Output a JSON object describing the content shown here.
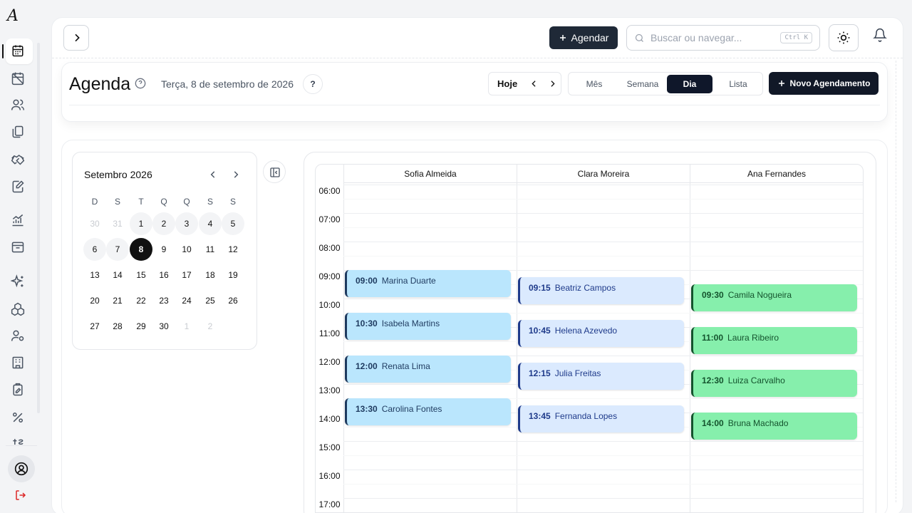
{
  "app": {
    "logo": "A"
  },
  "sidebar": {
    "items": [
      {
        "icon": "calendar-icon",
        "active": true
      },
      {
        "icon": "calendar-off-icon"
      },
      {
        "icon": "users-icon"
      },
      {
        "icon": "files-icon"
      },
      {
        "icon": "handshake-icon"
      },
      {
        "icon": "document-edit-icon"
      },
      {
        "icon": "chart-line-icon"
      },
      {
        "icon": "archive-icon"
      },
      {
        "icon": "sparkles-icon"
      },
      {
        "icon": "boxes-icon"
      },
      {
        "icon": "user-cog-icon"
      },
      {
        "icon": "building-icon"
      },
      {
        "icon": "clipboard-edit-icon"
      },
      {
        "icon": "percent-icon"
      },
      {
        "icon": "currency-icon"
      }
    ],
    "avatar_icon": "user-circle-icon",
    "logout_icon": "logout-icon"
  },
  "topbar": {
    "agendar_label": "Agendar",
    "search_placeholder": "Buscar ou navegar...",
    "search_shortcut": "Ctrl K"
  },
  "header": {
    "title": "Agenda",
    "date": "Terça, 8 de setembro de 2026",
    "help_label": "?",
    "today_label": "Hoje",
    "views": [
      "Mês",
      "Semana",
      "Dia",
      "Lista"
    ],
    "active_view": "Dia",
    "new_appointment_label": "Novo Agendamento"
  },
  "mini_calendar": {
    "month_label": "Setembro 2026",
    "weekdays": [
      "D",
      "S",
      "T",
      "Q",
      "Q",
      "S",
      "S"
    ],
    "weeks": [
      [
        {
          "d": "30",
          "m": true
        },
        {
          "d": "31",
          "m": true
        },
        {
          "d": "1",
          "hl": true
        },
        {
          "d": "2",
          "hl": true
        },
        {
          "d": "3",
          "hl": true
        },
        {
          "d": "4",
          "hl": true
        },
        {
          "d": "5",
          "hl": true
        }
      ],
      [
        {
          "d": "6",
          "hl": true
        },
        {
          "d": "7",
          "hl": true
        },
        {
          "d": "8",
          "today": true
        },
        {
          "d": "9"
        },
        {
          "d": "10"
        },
        {
          "d": "11"
        },
        {
          "d": "12"
        }
      ],
      [
        {
          "d": "13"
        },
        {
          "d": "14"
        },
        {
          "d": "15"
        },
        {
          "d": "16"
        },
        {
          "d": "17"
        },
        {
          "d": "18"
        },
        {
          "d": "19"
        }
      ],
      [
        {
          "d": "20"
        },
        {
          "d": "21"
        },
        {
          "d": "22"
        },
        {
          "d": "23"
        },
        {
          "d": "24"
        },
        {
          "d": "25"
        },
        {
          "d": "26"
        }
      ],
      [
        {
          "d": "27"
        },
        {
          "d": "28"
        },
        {
          "d": "29"
        },
        {
          "d": "30"
        },
        {
          "d": "1",
          "m": true
        },
        {
          "d": "2",
          "m": true
        }
      ]
    ]
  },
  "day_view": {
    "columns": [
      "Sofia Almeida",
      "Clara Moreira",
      "Ana Fernandes"
    ],
    "hours": [
      "06:00",
      "07:00",
      "08:00",
      "09:00",
      "10:00",
      "11:00",
      "12:00",
      "13:00",
      "14:00",
      "15:00",
      "16:00",
      "17:00"
    ],
    "events": [
      {
        "col": 0,
        "time": "09:00",
        "name": "Marina Duarte",
        "theme": "blue"
      },
      {
        "col": 0,
        "time": "10:30",
        "name": "Isabela Martins",
        "theme": "blue"
      },
      {
        "col": 0,
        "time": "12:00",
        "name": "Renata Lima",
        "theme": "blue"
      },
      {
        "col": 0,
        "time": "13:30",
        "name": "Carolina Fontes",
        "theme": "blue"
      },
      {
        "col": 1,
        "time": "09:15",
        "name": "Beatriz Campos",
        "theme": "lav"
      },
      {
        "col": 1,
        "time": "10:45",
        "name": "Helena Azevedo",
        "theme": "lav"
      },
      {
        "col": 1,
        "time": "12:15",
        "name": "Julia Freitas",
        "theme": "lav"
      },
      {
        "col": 1,
        "time": "13:45",
        "name": "Fernanda Lopes",
        "theme": "lav"
      },
      {
        "col": 2,
        "time": "09:30",
        "name": "Camila Nogueira",
        "theme": "green"
      },
      {
        "col": 2,
        "time": "11:00",
        "name": "Laura Ribeiro",
        "theme": "green"
      },
      {
        "col": 2,
        "time": "12:30",
        "name": "Luiza Carvalho",
        "theme": "green"
      },
      {
        "col": 2,
        "time": "14:00",
        "name": "Bruna Machado",
        "theme": "green"
      }
    ]
  },
  "colors": {
    "primary_dark": "#111827",
    "event_blue": "#bae6fd",
    "event_lavender": "#dbeafe",
    "event_green": "#86efac",
    "logout_red": "#dc2626"
  }
}
